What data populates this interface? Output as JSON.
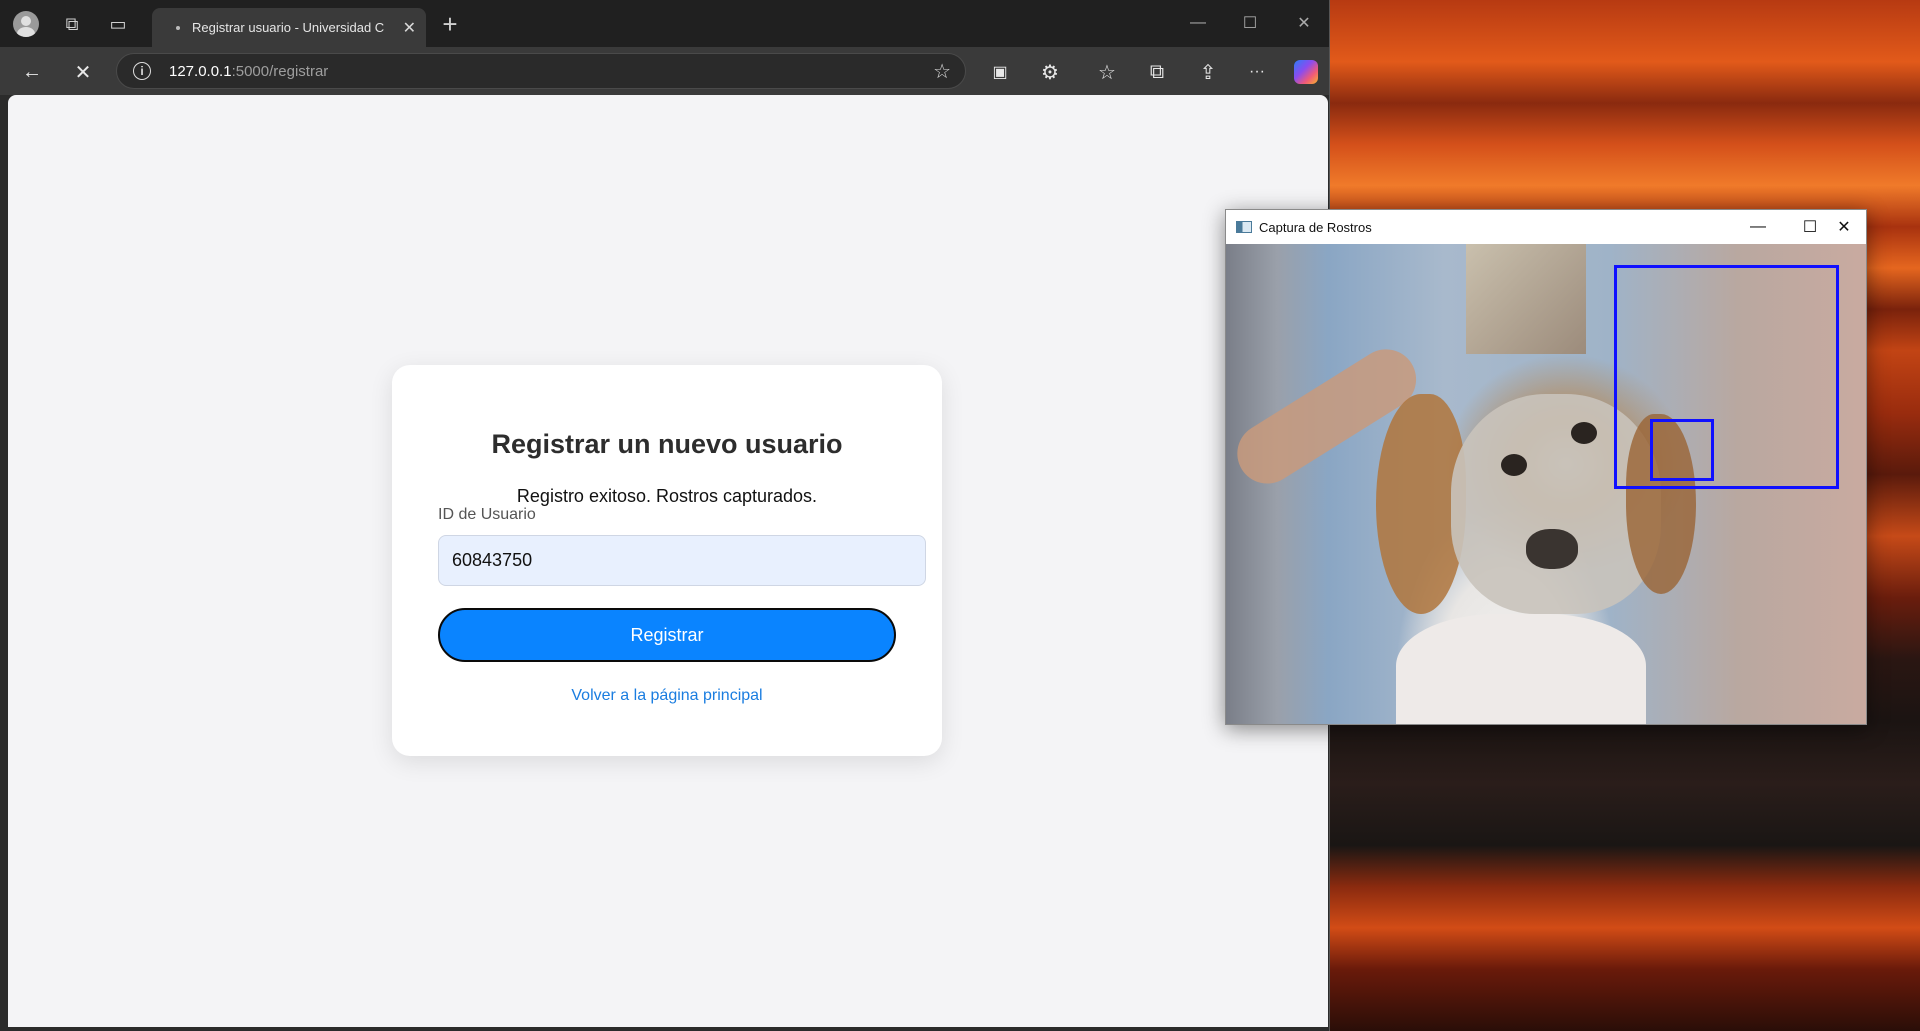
{
  "browser": {
    "tab_title": "Registrar usuario - Universidad C",
    "url_host": "127.0.0.1",
    "url_path": ":5000/registrar",
    "window_controls": {
      "minimize": "—",
      "maximize": "☐",
      "close": "✕"
    }
  },
  "page": {
    "heading": "Registrar un nuevo usuario",
    "message": "Registro exitoso. Rostros capturados.",
    "user_id_label": "ID de Usuario",
    "user_id_value": "60843750",
    "submit_label": "Registrar",
    "back_link": "Volver a la página principal"
  },
  "capture_window": {
    "title": "Captura de Rostros",
    "detection_color": "#1010ff"
  },
  "icons": {
    "back": "←",
    "stop": "✕",
    "info": "i",
    "star": "☆",
    "new_tab": "+",
    "tab_close": "✕",
    "extensions": "⚙",
    "favorites": "☆",
    "screenshot": "⧉",
    "share": "⇪",
    "more": "···",
    "minimize": "—",
    "maximize": "☐",
    "close": "✕"
  }
}
